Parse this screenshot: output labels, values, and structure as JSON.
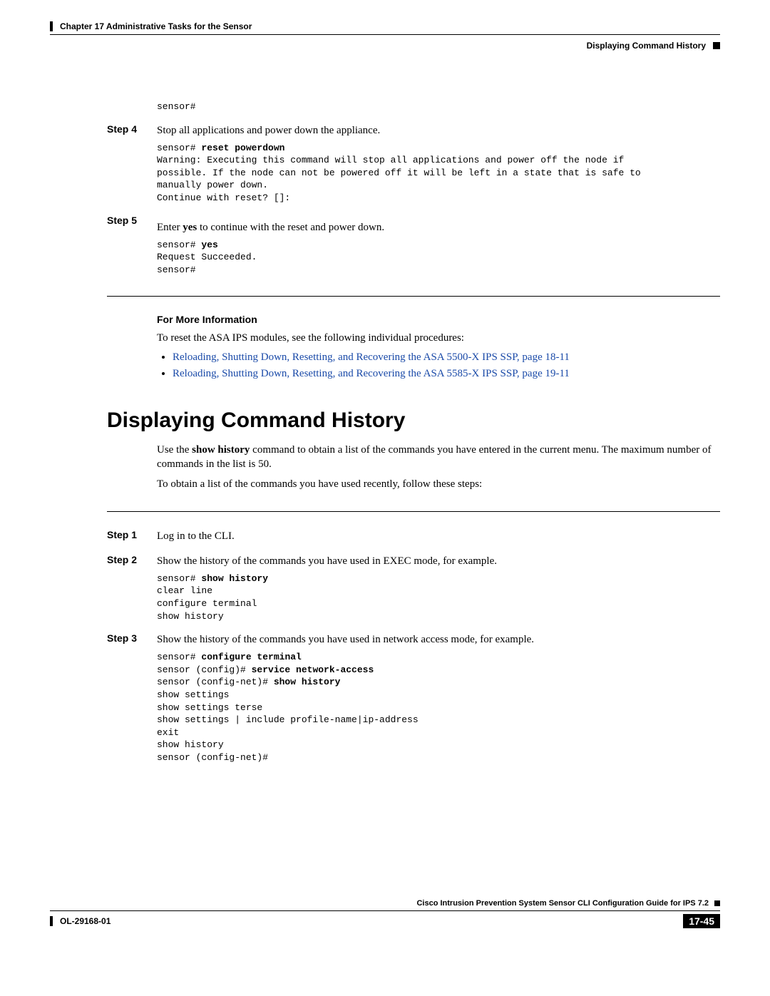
{
  "header": {
    "chapter": "Chapter 17    Administrative Tasks for the Sensor",
    "section": "Displaying Command History"
  },
  "pre0": "sensor#",
  "step4": {
    "label": "Step 4",
    "text": "Stop all applications and power down the appliance.",
    "code_prefix": "sensor# ",
    "code_bold": "reset powerdown",
    "code_rest": "\nWarning: Executing this command will stop all applications and power off the node if \npossible. If the node can not be powered off it will be left in a state that is safe to \nmanually power down.\nContinue with reset? []:"
  },
  "step5": {
    "label": "Step 5",
    "text_pre": "Enter ",
    "text_bold": "yes",
    "text_post": " to continue with the reset and power down.",
    "code_prefix": "sensor# ",
    "code_bold": "yes",
    "code_rest": "\nRequest Succeeded.\nsensor#"
  },
  "moreinfo": {
    "heading": "For More Information",
    "intro": "To reset the ASA IPS modules, see the following individual procedures:",
    "links": [
      "Reloading, Shutting Down, Resetting, and Recovering the ASA 5500-X IPS SSP, page 18-11",
      "Reloading, Shutting Down, Resetting, and Recovering the ASA 5585-X IPS SSP, page 19-11"
    ]
  },
  "h1": "Displaying Command History",
  "intro_pre": "Use the ",
  "intro_bold": "show history",
  "intro_post": " command to obtain a list of the commands you have entered in the current menu. The maximum number of commands in the list is 50.",
  "intro2": "To obtain a list of the commands you have used recently, follow these steps:",
  "step1": {
    "label": "Step 1",
    "text": "Log in to the CLI."
  },
  "step2": {
    "label": "Step 2",
    "text": "Show the history of the commands you have used in EXEC mode, for example.",
    "code_prefix": "sensor# ",
    "code_bold": "show history",
    "code_rest": "\nclear line\nconfigure terminal\nshow history"
  },
  "step3": {
    "label": "Step 3",
    "text": "Show the history of the commands you have used in network access mode, for example.",
    "code_l1a": "sensor# ",
    "code_l1b": "configure terminal",
    "code_l2a": "\nsensor (config)# ",
    "code_l2b": "service network-access",
    "code_l3a": "\nsensor (config-net)# ",
    "code_l3b": "show history",
    "code_rest": "\nshow settings\nshow settings terse\nshow settings | include profile-name|ip-address\nexit\nshow history\nsensor (config-net)#"
  },
  "footer": {
    "guide": "Cisco Intrusion Prevention System Sensor CLI Configuration Guide for IPS 7.2",
    "docnum": "OL-29168-01",
    "pagenum": "17-45"
  }
}
